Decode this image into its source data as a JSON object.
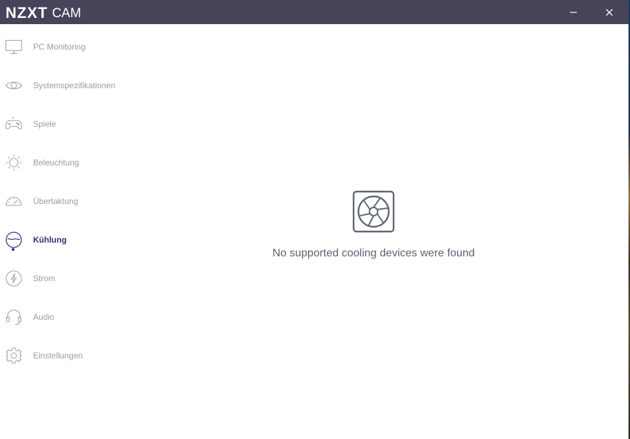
{
  "app": {
    "logo_brand": "NZXT",
    "logo_product": "CAM"
  },
  "colors": {
    "titlebar": "#464458",
    "accent": "#4a2c78",
    "nav_inactive": "#9a9aa6",
    "empty_text": "#5b6170"
  },
  "sidebar": {
    "active_index": 5,
    "items": [
      {
        "label": "PC Monitoring",
        "icon": "monitor-icon"
      },
      {
        "label": "Systemspezifikationen",
        "icon": "eye-icon"
      },
      {
        "label": "Spiele",
        "icon": "gamepad-icon"
      },
      {
        "label": "Beleuchtung",
        "icon": "sun-icon"
      },
      {
        "label": "Übertaktung",
        "icon": "speedometer-icon"
      },
      {
        "label": "Kühlung",
        "icon": "liquid-cooling-icon"
      },
      {
        "label": "Strom",
        "icon": "lightning-icon"
      },
      {
        "label": "Audio",
        "icon": "headset-icon"
      },
      {
        "label": "Einstellungen",
        "icon": "gear-icon"
      }
    ]
  },
  "main": {
    "empty_icon": "fan-icon",
    "empty_message": "No supported cooling devices were found"
  }
}
